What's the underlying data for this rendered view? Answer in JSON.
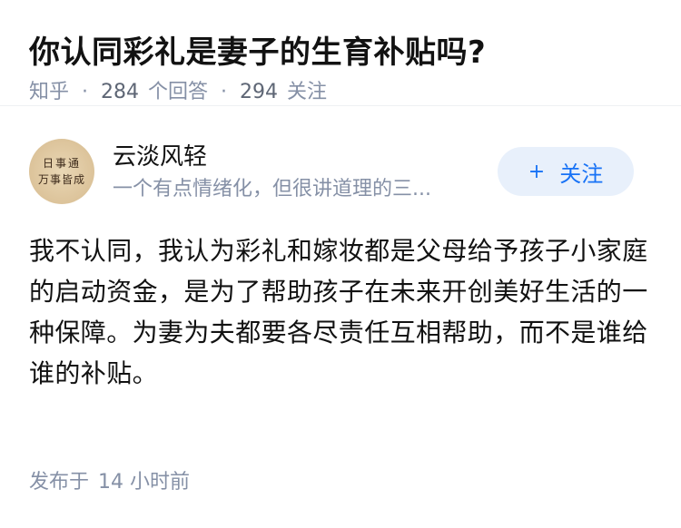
{
  "question": {
    "title": "你认同彩礼是妻子的生育补贴吗?",
    "source": "知乎",
    "answer_count": "284",
    "answer_label": "个回答",
    "follower_count": "294",
    "follower_label": "关注",
    "separator": "·"
  },
  "author": {
    "name": "云淡风轻",
    "bio": "一个有点情绪化，但很讲道理的三...",
    "avatar_text_line1": "日事通",
    "avatar_text_line2": "万事皆成",
    "follow_icon": "+",
    "follow_label": "关注"
  },
  "answer": {
    "text": "我不认同，我认为彩礼和嫁妆都是父母给予孩子小家庭的启动资金，是为了帮助孩子在未来开创美好生活的一种保障。为妻为夫都要各尽责任互相帮助，而不是谁给谁的补贴。",
    "published_label": "发布于",
    "published_time": "14 小时前"
  },
  "colors": {
    "primary": "#1772f6",
    "muted": "#8590a6",
    "follow_bg": "#e8f0fb"
  }
}
